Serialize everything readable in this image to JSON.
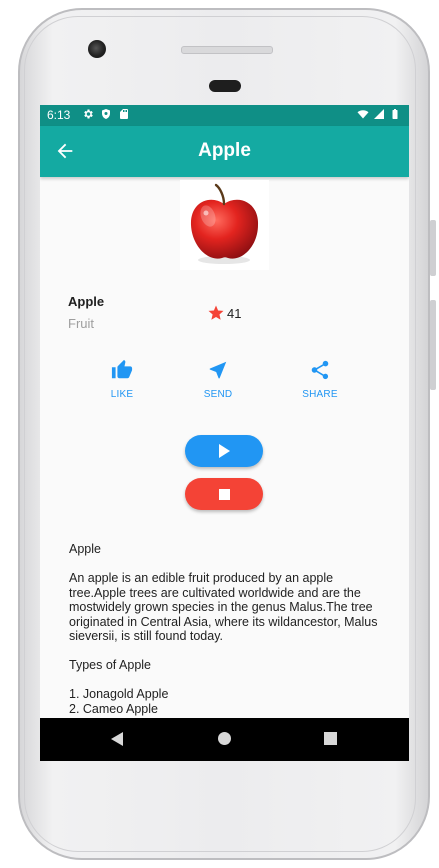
{
  "status_bar": {
    "time": "6:13",
    "left_icons": [
      "gear-icon",
      "shield-icon",
      "sd-card-icon"
    ],
    "right_icons": [
      "wifi-icon",
      "signal-icon",
      "battery-icon"
    ],
    "color": "#0f8f86"
  },
  "app_bar": {
    "title": "Apple",
    "back_icon": "arrow-left-icon",
    "color": "#14aaa2"
  },
  "item": {
    "name": "Apple",
    "category": "Fruit",
    "rating_icon": "star-icon",
    "rating": "41"
  },
  "actions": [
    {
      "label": "LIKE",
      "icon": "thumb-up-icon"
    },
    {
      "label": "SEND",
      "icon": "send-icon"
    },
    {
      "label": "SHARE",
      "icon": "share-icon"
    }
  ],
  "controls": {
    "play_icon": "play-icon",
    "stop_icon": "stop-icon",
    "play_color": "#2196f3",
    "stop_color": "#f44336"
  },
  "description": {
    "title": "Apple",
    "body": "An apple is an edible fruit produced by an apple tree.Apple trees are cultivated worldwide and are the mostwidely grown species in the genus Malus.The tree originated in Central Asia, where its wildancestor, Malus sieversii, is still found today.",
    "types_heading": "Types of Apple",
    "types": [
      "1. Jonagold Apple",
      "2. Cameo Apple"
    ]
  },
  "nav_bar": {
    "icons": [
      "back-triangle-icon",
      "home-circle-icon",
      "recents-square-icon"
    ]
  },
  "accent_color": "#2196f3"
}
